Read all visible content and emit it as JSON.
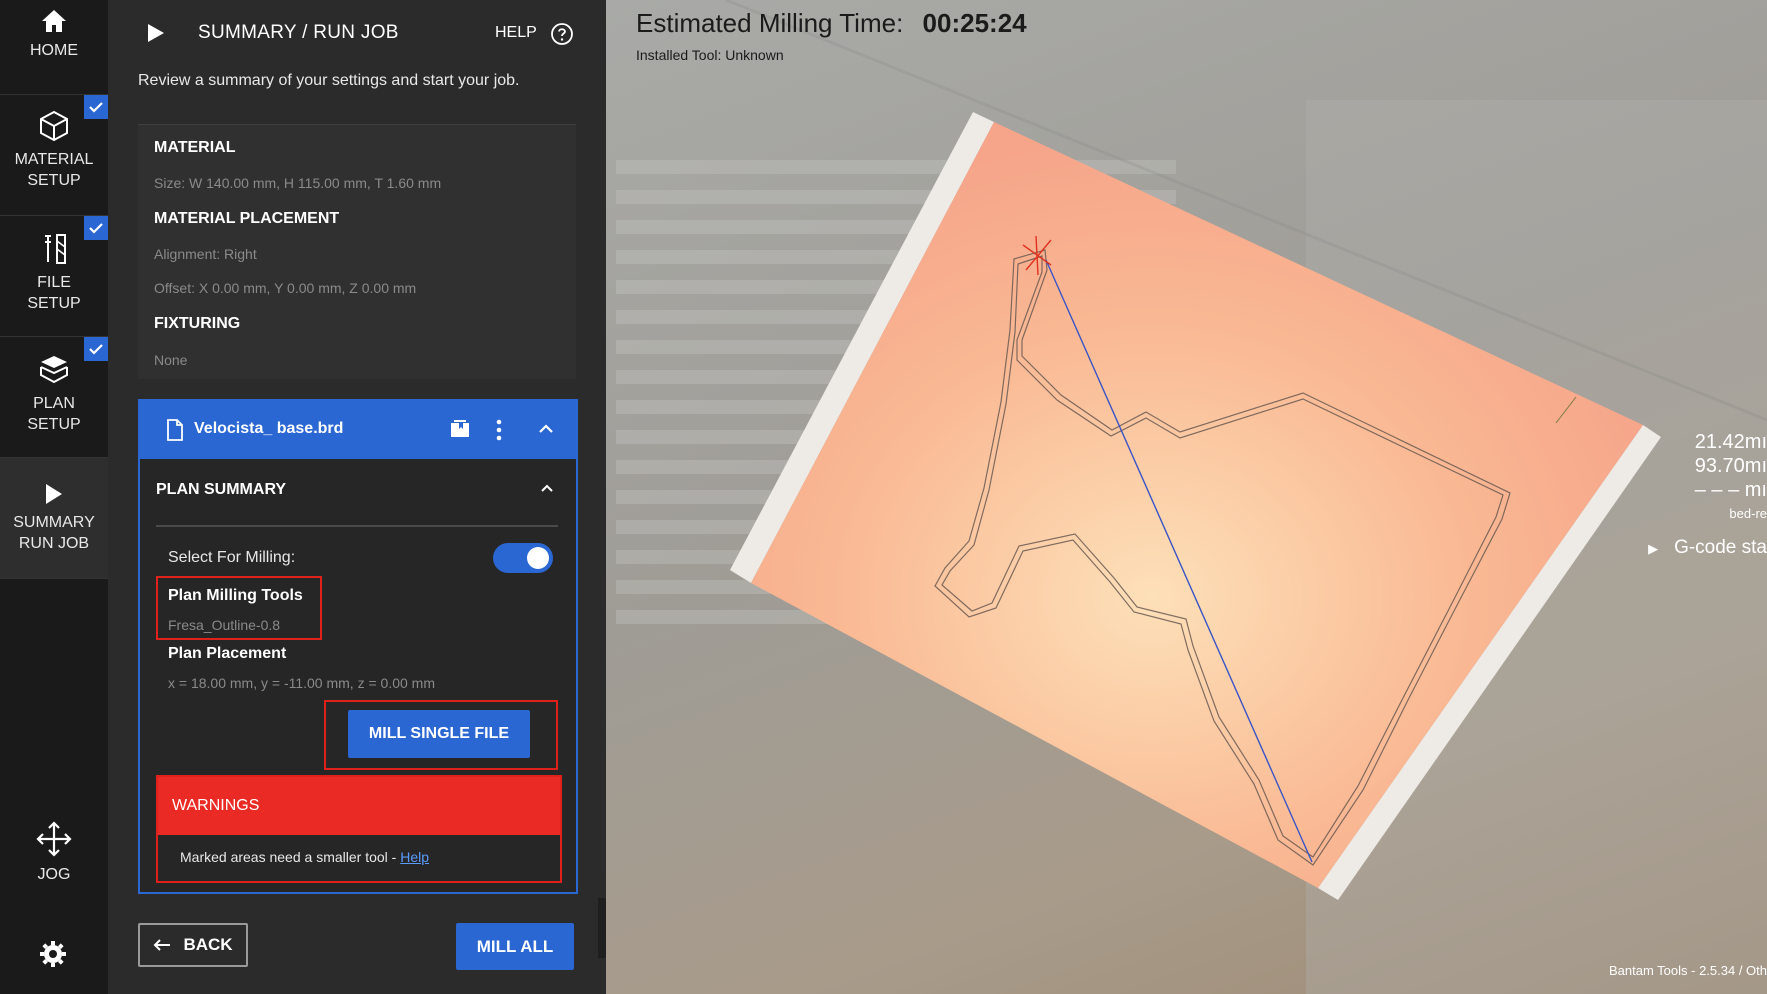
{
  "nav": {
    "home": "HOME",
    "material_setup": [
      "MATERIAL",
      "SETUP"
    ],
    "file_setup": [
      "FILE",
      "SETUP"
    ],
    "plan_setup": [
      "PLAN",
      "SETUP"
    ],
    "summary": [
      "SUMMARY",
      "RUN JOB"
    ],
    "jog": "JOG"
  },
  "header": {
    "title": "SUMMARY / RUN JOB",
    "help": "HELP",
    "intro": "Review a summary of your settings and start your job."
  },
  "summary": {
    "material_h": "MATERIAL",
    "material_size": "Size:  W 140.00 mm, H 115.00 mm, T 1.60 mm",
    "placement_h": "MATERIAL PLACEMENT",
    "alignment": "Alignment:  Right",
    "offset": "Offset:  X 0.00 mm, Y 0.00 mm, Z 0.00 mm",
    "fixturing_h": "FIXTURING",
    "fixturing": "None"
  },
  "file": {
    "name": "Velocista_ base.brd",
    "plan_summary": "PLAN SUMMARY",
    "select_label": "Select For Milling:",
    "tools_label": "Plan Milling Tools",
    "tools_value": "Fresa_Outline-0.8",
    "placement_label": "Plan Placement",
    "placement_value": "x = 18.00 mm, y = -11.00 mm, z = 0.00 mm",
    "mill_single": "MILL SINGLE FILE",
    "warnings_h": "WARNINGS",
    "warning_text": "Marked areas need a smaller tool - ",
    "warning_link": "Help"
  },
  "footer_buttons": {
    "back": "BACK",
    "mill_all": "MILL ALL"
  },
  "viewport": {
    "est_label": "Estimated Milling Time:",
    "est_value": "00:25:24",
    "installed_tool": "Installed Tool: Unknown",
    "dim1": "21.42mı",
    "dim2": "93.70mı",
    "dim3": "– – – mı",
    "dim4": "bed-re",
    "gcode": "G-code sta",
    "version": "Bantam Tools - 2.5.34 / Oth"
  },
  "colors": {
    "accent": "#2a67d3",
    "warning": "#ea2b25",
    "board": "#f6a58a"
  }
}
